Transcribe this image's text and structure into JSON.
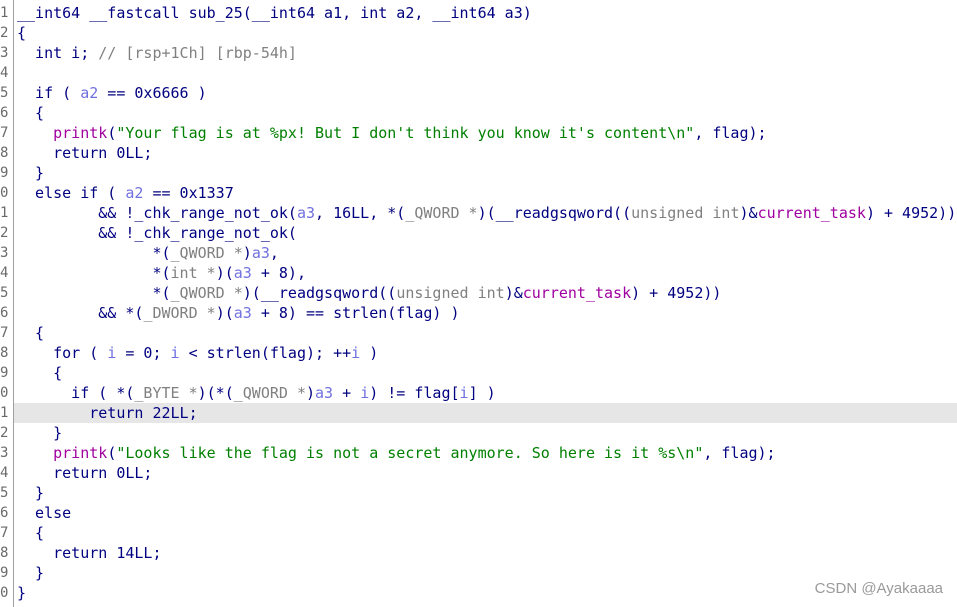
{
  "gutter": [
    "1",
    "2",
    "3",
    "4",
    "5",
    "6",
    "7",
    "8",
    "9",
    "0",
    "1",
    "2",
    "3",
    "4",
    "5",
    "6",
    "7",
    "8",
    "9",
    "0",
    "1",
    "2",
    "3",
    "4",
    "5",
    "6",
    "7",
    "8",
    "9",
    "0"
  ],
  "lines": [
    [
      {
        "t": "__int64 __fastcall sub_25(__int64 a1, int a2, __int64 a3)",
        "c": "pl"
      }
    ],
    [
      {
        "t": "{",
        "c": "pl"
      }
    ],
    [
      {
        "t": "  int i; ",
        "c": "pl"
      },
      {
        "t": "// [rsp+1Ch] [rbp-54h]",
        "c": "gr"
      }
    ],
    [
      {
        "t": "",
        "c": "pl"
      }
    ],
    [
      {
        "t": "  if ( ",
        "c": "pl"
      },
      {
        "t": "a2",
        "c": "lv"
      },
      {
        "t": " == 0x6666 )",
        "c": "pl"
      }
    ],
    [
      {
        "t": "  {",
        "c": "pl"
      }
    ],
    [
      {
        "t": "    ",
        "c": "pl"
      },
      {
        "t": "printk",
        "c": "fn"
      },
      {
        "t": "(",
        "c": "pl"
      },
      {
        "t": "\"Your flag is at %px! But I don't think you know it's content\\n\"",
        "c": "st"
      },
      {
        "t": ", flag);",
        "c": "pl"
      }
    ],
    [
      {
        "t": "    return 0LL;",
        "c": "pl"
      }
    ],
    [
      {
        "t": "  }",
        "c": "pl"
      }
    ],
    [
      {
        "t": "  else if ( ",
        "c": "pl"
      },
      {
        "t": "a2",
        "c": "lv"
      },
      {
        "t": " == 0x1337",
        "c": "pl"
      }
    ],
    [
      {
        "t": "         && !_chk_range_not_ok(",
        "c": "pl"
      },
      {
        "t": "a3",
        "c": "lv"
      },
      {
        "t": ", 16LL, *(",
        "c": "pl"
      },
      {
        "t": "_QWORD *",
        "c": "gr"
      },
      {
        "t": ")(__readgsqword((",
        "c": "pl"
      },
      {
        "t": "unsigned int",
        "c": "gr"
      },
      {
        "t": ")&",
        "c": "pl"
      },
      {
        "t": "current_task",
        "c": "fn"
      },
      {
        "t": ") + 4952))",
        "c": "pl"
      }
    ],
    [
      {
        "t": "         && !_chk_range_not_ok(",
        "c": "pl"
      }
    ],
    [
      {
        "t": "               *(",
        "c": "pl"
      },
      {
        "t": "_QWORD *",
        "c": "gr"
      },
      {
        "t": ")",
        "c": "pl"
      },
      {
        "t": "a3",
        "c": "lv"
      },
      {
        "t": ",",
        "c": "pl"
      }
    ],
    [
      {
        "t": "               *(",
        "c": "pl"
      },
      {
        "t": "int *",
        "c": "gr"
      },
      {
        "t": ")(",
        "c": "pl"
      },
      {
        "t": "a3",
        "c": "lv"
      },
      {
        "t": " + 8),",
        "c": "pl"
      }
    ],
    [
      {
        "t": "               *(",
        "c": "pl"
      },
      {
        "t": "_QWORD *",
        "c": "gr"
      },
      {
        "t": ")(__readgsqword((",
        "c": "pl"
      },
      {
        "t": "unsigned int",
        "c": "gr"
      },
      {
        "t": ")&",
        "c": "pl"
      },
      {
        "t": "current_task",
        "c": "fn"
      },
      {
        "t": ") + 4952))",
        "c": "pl"
      }
    ],
    [
      {
        "t": "         && *(",
        "c": "pl"
      },
      {
        "t": "_DWORD *",
        "c": "gr"
      },
      {
        "t": ")(",
        "c": "pl"
      },
      {
        "t": "a3",
        "c": "lv"
      },
      {
        "t": " + 8) == strlen(flag) )",
        "c": "pl"
      }
    ],
    [
      {
        "t": "  {",
        "c": "pl"
      }
    ],
    [
      {
        "t": "    for ( ",
        "c": "pl"
      },
      {
        "t": "i",
        "c": "lv"
      },
      {
        "t": " = 0; ",
        "c": "pl"
      },
      {
        "t": "i",
        "c": "lv"
      },
      {
        "t": " < strlen(flag); ++",
        "c": "pl"
      },
      {
        "t": "i",
        "c": "lv"
      },
      {
        "t": " )",
        "c": "pl"
      }
    ],
    [
      {
        "t": "    {",
        "c": "pl"
      }
    ],
    [
      {
        "t": "      if ( *(",
        "c": "pl"
      },
      {
        "t": "_BYTE *",
        "c": "gr"
      },
      {
        "t": ")(*(",
        "c": "pl"
      },
      {
        "t": "_QWORD *",
        "c": "gr"
      },
      {
        "t": ")",
        "c": "pl"
      },
      {
        "t": "a3",
        "c": "lv"
      },
      {
        "t": " + ",
        "c": "pl"
      },
      {
        "t": "i",
        "c": "lv"
      },
      {
        "t": ") != flag[",
        "c": "pl"
      },
      {
        "t": "i",
        "c": "lv"
      },
      {
        "t": "] )",
        "c": "pl"
      }
    ],
    [
      {
        "t": "        return 22LL;",
        "c": "pl"
      }
    ],
    [
      {
        "t": "    }",
        "c": "pl"
      }
    ],
    [
      {
        "t": "    ",
        "c": "pl"
      },
      {
        "t": "printk",
        "c": "fn"
      },
      {
        "t": "(",
        "c": "pl"
      },
      {
        "t": "\"Looks like the flag is not a secret anymore. So here is it %s\\n\"",
        "c": "st"
      },
      {
        "t": ", flag);",
        "c": "pl"
      }
    ],
    [
      {
        "t": "    return 0LL;",
        "c": "pl"
      }
    ],
    [
      {
        "t": "  }",
        "c": "pl"
      }
    ],
    [
      {
        "t": "  else",
        "c": "pl"
      }
    ],
    [
      {
        "t": "  {",
        "c": "pl"
      }
    ],
    [
      {
        "t": "    return 14LL;",
        "c": "pl"
      }
    ],
    [
      {
        "t": "  }",
        "c": "pl"
      }
    ],
    [
      {
        "t": "}",
        "c": "pl"
      }
    ]
  ],
  "highlighted_line": 21,
  "watermark": "CSDN @Ayakaaaa"
}
